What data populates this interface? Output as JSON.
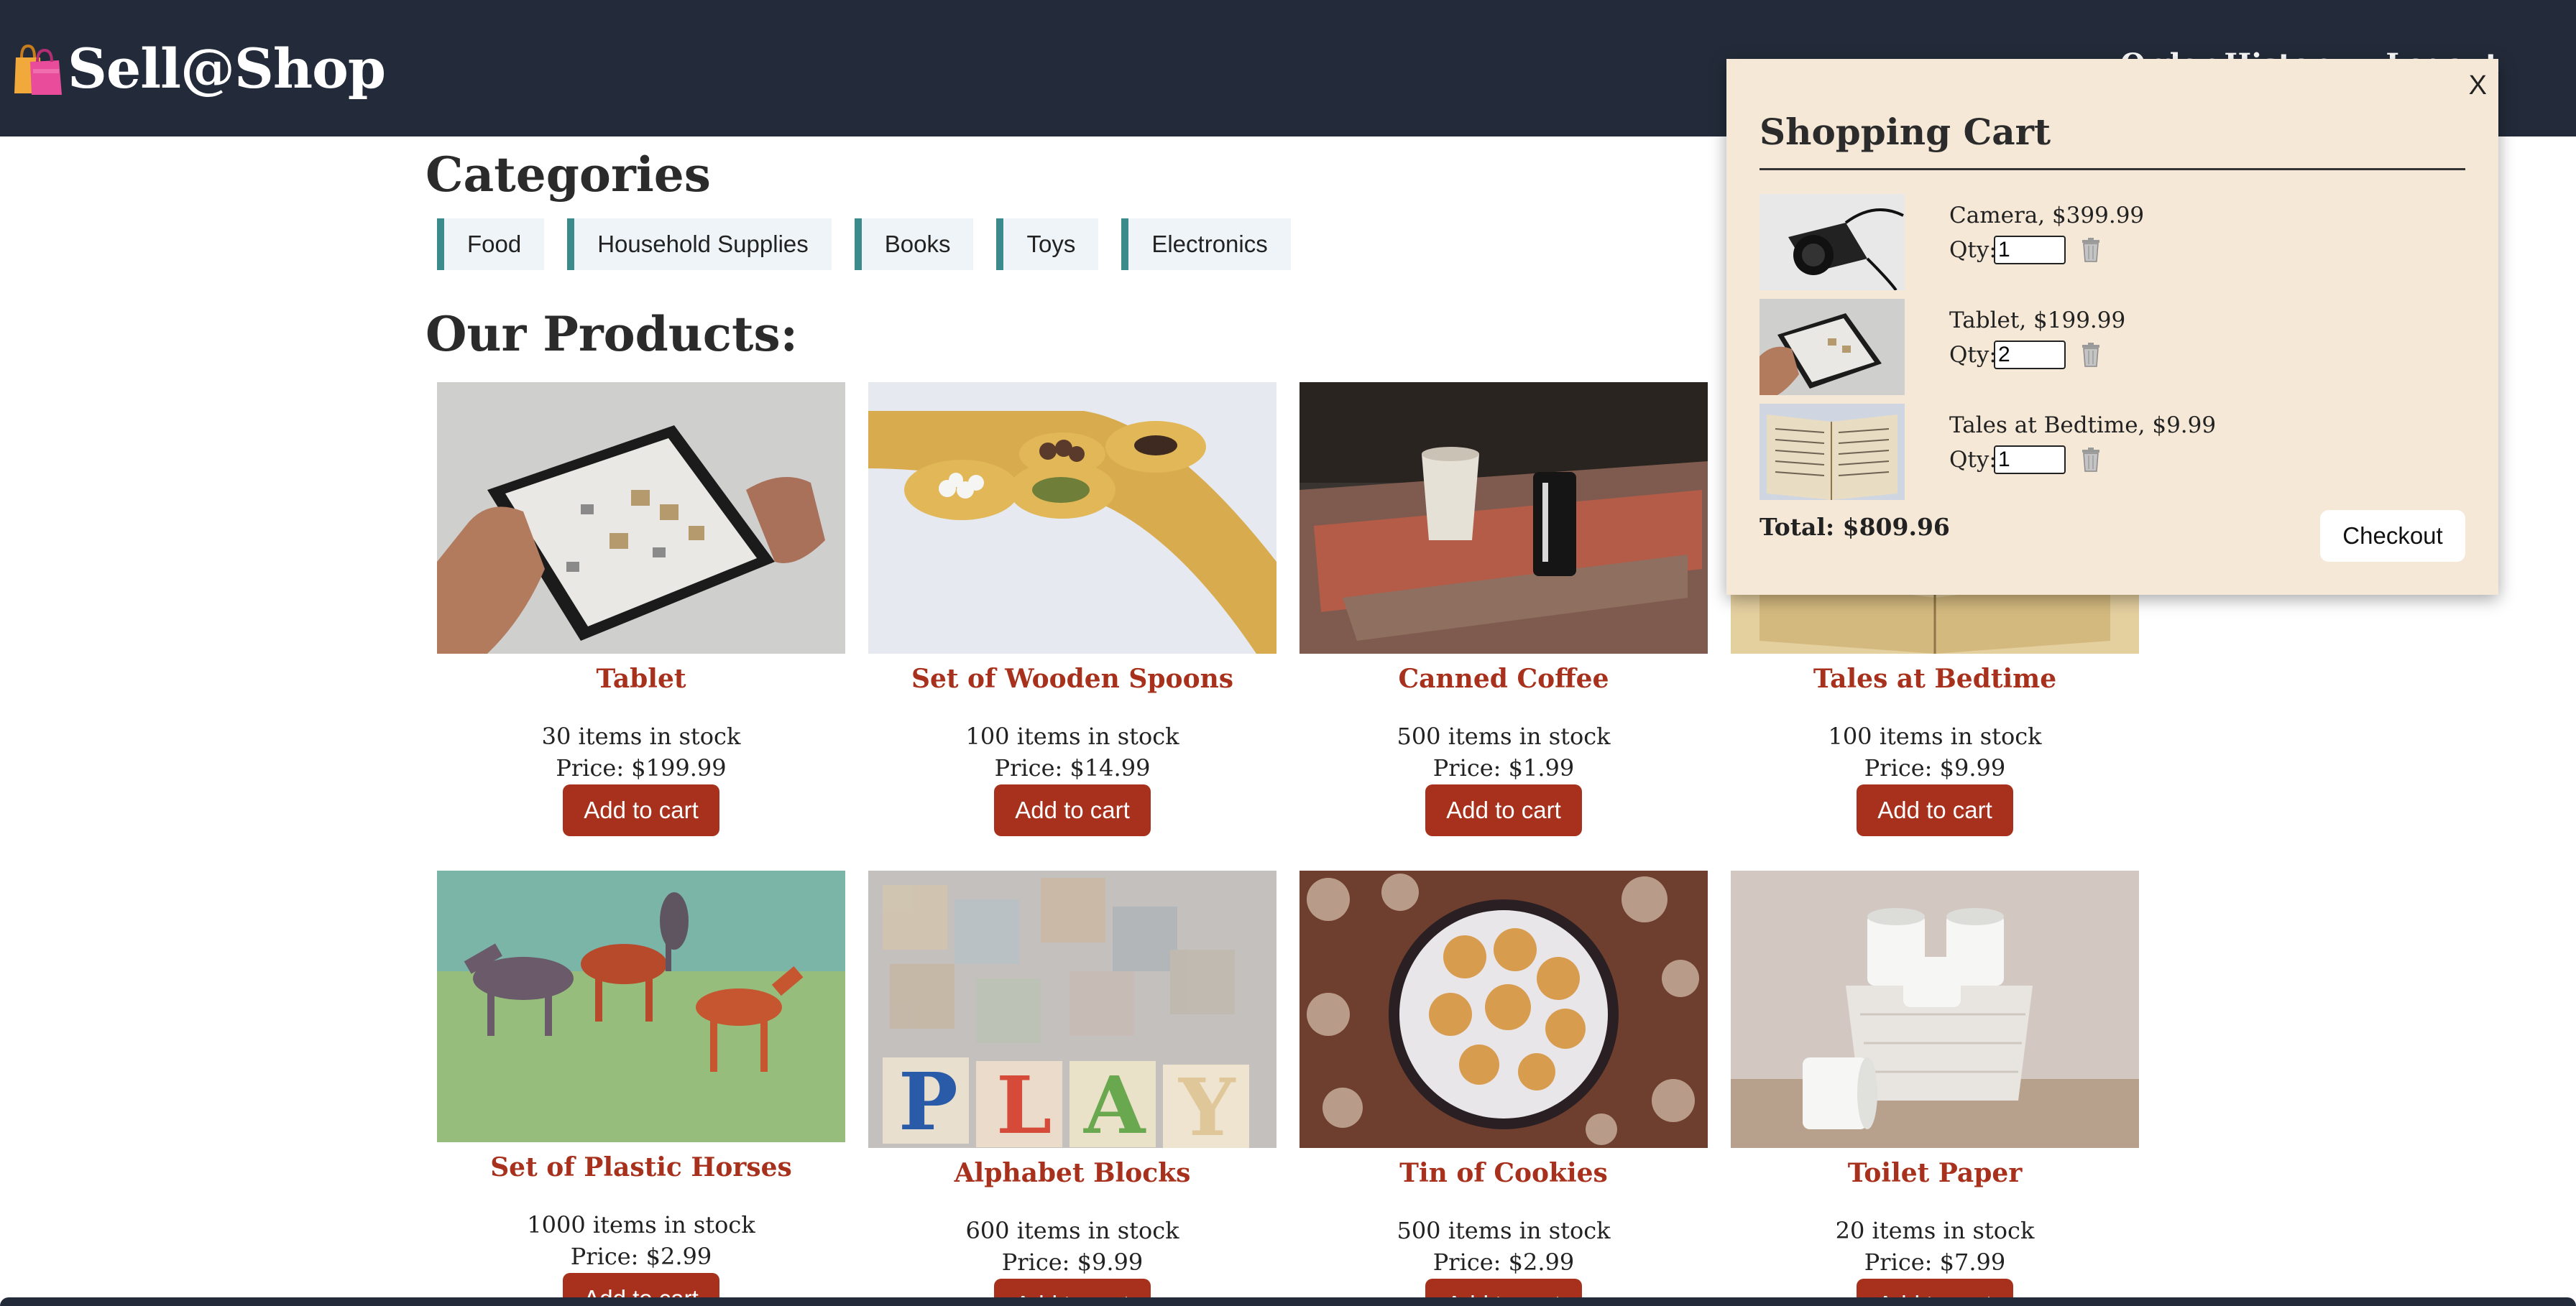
{
  "header": {
    "brand": "Sell@Shop",
    "brand_icon": "shopping-bags-icon",
    "nav": [
      "Order History",
      "Logout"
    ]
  },
  "categories": {
    "title": "Categories",
    "items": [
      "Food",
      "Household Supplies",
      "Books",
      "Toys",
      "Electronics"
    ]
  },
  "products": {
    "title": "Our Products:",
    "add_label": "Add to cart",
    "items": [
      {
        "name": "Tablet",
        "stock": "30 items in stock",
        "price": "Price: $199.99"
      },
      {
        "name": "Set of Wooden Spoons",
        "stock": "100 items in stock",
        "price": "Price: $14.99"
      },
      {
        "name": "Canned Coffee",
        "stock": "500 items in stock",
        "price": "Price: $1.99"
      },
      {
        "name": "Tales at Bedtime",
        "stock": "100 items in stock",
        "price": "Price: $9.99"
      },
      {
        "name": "Set of Plastic Horses",
        "stock": "1000 items in stock",
        "price": "Price: $2.99"
      },
      {
        "name": "Alphabet Blocks",
        "stock": "600 items in stock",
        "price": "Price: $9.99"
      },
      {
        "name": "Tin of Cookies",
        "stock": "500 items in stock",
        "price": "Price: $2.99"
      },
      {
        "name": "Toilet Paper",
        "stock": "20 items in stock",
        "price": "Price: $7.99"
      }
    ]
  },
  "cart": {
    "close_label": "X",
    "title": "Shopping Cart",
    "qty_label": "Qty:",
    "items": [
      {
        "label": "Camera, $399.99",
        "qty": "1"
      },
      {
        "label": "Tablet, $199.99",
        "qty": "2"
      },
      {
        "label": "Tales at Bedtime, $9.99",
        "qty": "1"
      }
    ],
    "total": "Total: $809.96",
    "checkout_label": "Checkout"
  },
  "colors": {
    "header_bg": "#232b3a",
    "accent": "#a7311c",
    "category_border": "#3b8b8d",
    "cart_bg": "#f5e8d7"
  }
}
